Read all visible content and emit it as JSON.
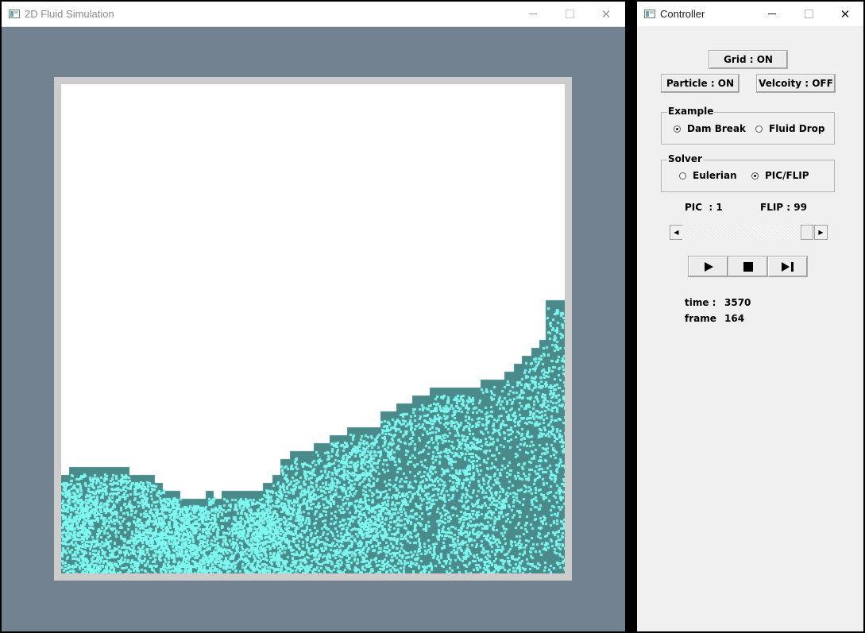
{
  "sim_window": {
    "title": "2D Fluid Simulation",
    "colors": {
      "background": "#728291",
      "frame": "#cccccc",
      "grid_fluid": "#4a8a8a",
      "particle": "#7ef7f0",
      "empty": "#ffffff"
    },
    "buttons": {
      "minimize": "—",
      "maximize": "□",
      "close": "✕"
    }
  },
  "ctrl_window": {
    "title": "Controller",
    "buttons": {
      "minimize": "—",
      "maximize": "□",
      "close": "✕"
    },
    "grid_button": "Grid : ON",
    "particle_button": "Particle : ON",
    "velocity_button": "Velcoity : OFF",
    "example": {
      "label": "Example",
      "options": [
        "Dam Break",
        "Fluid Drop"
      ],
      "selected": "Dam Break"
    },
    "solver": {
      "label": "Solver",
      "options": [
        "Eulerian",
        "PIC/FLIP"
      ],
      "selected": "PIC/FLIP"
    },
    "pic_label": "PIC  : 1",
    "flip_label": "FLIP : 99",
    "pic_flip_slider": {
      "min": 0,
      "max": 100,
      "value": 99
    },
    "playback": {
      "play_icon": "play-icon",
      "stop_icon": "stop-icon",
      "step_icon": "step-forward-icon"
    },
    "time_label": "time :",
    "time_value": "3570",
    "frame_label": "frame",
    "frame_value": "164"
  }
}
